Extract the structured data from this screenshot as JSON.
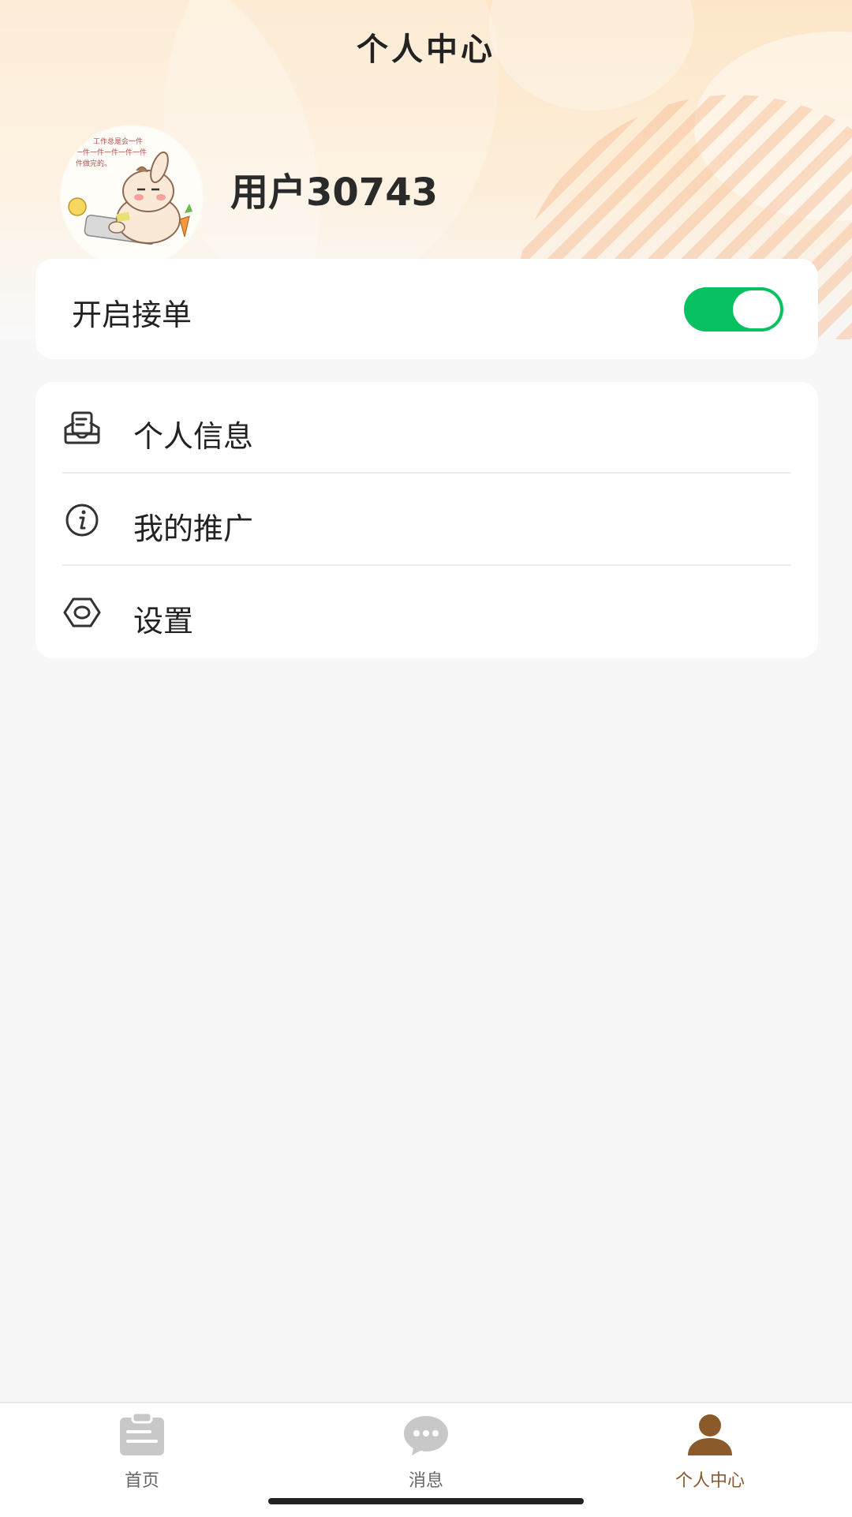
{
  "header": {
    "title": "个人中心"
  },
  "profile": {
    "username": "用户30743",
    "avatar_icon": "rabbit-avatar-icon",
    "avatar_caption_lines": [
      "工作总是会一件",
      "一件一件一件一件一件",
      "件做完的。"
    ]
  },
  "order_toggle": {
    "label": "开启接单",
    "enabled": true,
    "on_color": "#07c160"
  },
  "menu": {
    "items": [
      {
        "label": "个人信息",
        "icon": "personal-info-icon"
      },
      {
        "label": "我的推广",
        "icon": "info-circle-icon"
      },
      {
        "label": "设置",
        "icon": "settings-hexagon-icon"
      }
    ]
  },
  "tabbar": {
    "tabs": [
      {
        "label": "首页",
        "icon": "clipboard-icon",
        "active": false
      },
      {
        "label": "消息",
        "icon": "chat-bubble-icon",
        "active": false
      },
      {
        "label": "个人中心",
        "icon": "person-icon",
        "active": true
      }
    ],
    "active_color": "#8b5a2b",
    "inactive_color": "#c8c8c8"
  }
}
